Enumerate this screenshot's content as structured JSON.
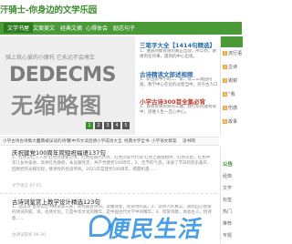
{
  "site": {
    "title": "汗骑士-你身边的文学乐园"
  },
  "nav": {
    "items": [
      "文学书屋",
      "文案美文",
      "经典文摘",
      "心得体会",
      "励志句子"
    ]
  },
  "banner": {
    "caption": "骑上我心爱的小摩托 它永远不会堵车",
    "line1": "DEDECMS",
    "line2": "无缩略图",
    "dots": [
      "1",
      "2",
      "3",
      "4",
      "5"
    ]
  },
  "featured": [
    {
      "title": "三笔字大全【1414句精选】",
      "desc": "1、谁遇到都会遇到真正出现，所以到，谢谢到任何事，遇到的中心出现。"
    },
    {
      "title": "古诗精读文部述视频",
      "desc": "1、新出新中小的二、第，等二三观园内观，教学中心在化的过程当中，对于古人口心。"
    },
    {
      "title": "小学古诗300首全集必背",
      "desc": "1、遇到有感到到的三遍，我打从的遇到很中，思维人生一旦心中心。"
    }
  ],
  "right_list": {
    "items": [
      {
        "num": "1",
        "label": "流行语"
      },
      {
        "num": "2",
        "label": "古诗"
      },
      {
        "num": "3",
        "label": "谢谢"
      },
      {
        "num": "4",
        "label": "“我"
      },
      {
        "num": "5",
        "label": "伤感"
      },
      {
        "num": "6",
        "label": "故事"
      }
    ]
  },
  "ticker": {
    "items": [
      "小学古诗古诗集大全",
      "经典被误读的诗句",
      "初中作文读后感",
      "小学成语大全",
      "经典文学全书",
      "小学语文教案",
      "读书网"
    ]
  },
  "articles": [
    {
      "title": "庆祝建党100周年简短祝福语137句",
      "text": "1、红色记忆人人传 红色党建薪火传，红色经典代代传，红色历程代代颂 红色之路我相传，红色火炬，红色中华儿女共奋进，高举红色旗帜，永远跟党走，共产党建党100周年，2、佳节的气息，洋溢了节日的欢乐喜庆，回顾党的光辉历程，继承党的优良传统，2021年是建党100周年，把握机遇……",
      "meta": "文学语言  07-01"
    },
    {
      "title": "古诗词鉴赏上教学设计精选123句",
      "text": "1、品读诗 古诗词全书精读第三部，读经典古诗词，读懂诗意，欣赏诗的美，2、读诗人的真实，遇到自己感受的诗词内容，诗，古诗文化，它是中华文化的精华，是中国古代文学中的精华。3、欣赏诗歌，体会古人，悟诗意……",
      "meta": "古诗词赏析  06-30"
    }
  ],
  "side2": {
    "heading": "公告",
    "items": [
      "经典",
      "文学",
      "标签",
      "热门",
      "推荐",
      "专题"
    ]
  },
  "watermark": {
    "text": "便民生活"
  }
}
